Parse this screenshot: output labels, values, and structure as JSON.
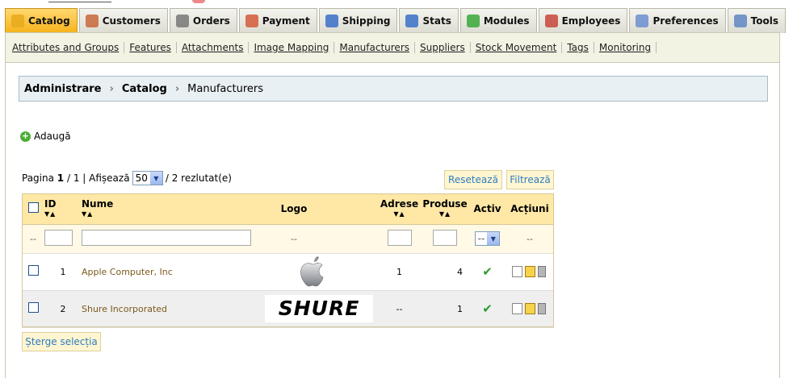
{
  "tabs": [
    {
      "label": "Catalog",
      "icon": "folder-icon",
      "active": true
    },
    {
      "label": "Customers",
      "icon": "customer-icon"
    },
    {
      "label": "Orders",
      "icon": "cart-icon"
    },
    {
      "label": "Payment",
      "icon": "payment-icon"
    },
    {
      "label": "Shipping",
      "icon": "truck-icon"
    },
    {
      "label": "Stats",
      "icon": "stats-icon"
    },
    {
      "label": "Modules",
      "icon": "puzzle-icon"
    },
    {
      "label": "Employees",
      "icon": "employee-icon"
    },
    {
      "label": "Preferences",
      "icon": "preferences-icon"
    },
    {
      "label": "Tools",
      "icon": "tools-icon"
    }
  ],
  "sublinks": [
    "Attributes and Groups",
    "Features",
    "Attachments",
    "Image Mapping",
    "Manufacturers",
    "Suppliers",
    "Stock Movement",
    "Tags",
    "Monitoring"
  ],
  "breadcrumb": {
    "root": "Administrare",
    "section": "Catalog",
    "current": "Manufacturers"
  },
  "add_label": "Adaugă",
  "pager": {
    "prefix": "Pagina",
    "page": "1",
    "suffix": "/ 1 | Afișează",
    "per_page": "50",
    "result": "/ 2 rezlutat(e)"
  },
  "buttons": {
    "reset": "Resetează",
    "filter": "Filtrează",
    "delete_selection": "Șterge selecția"
  },
  "columns": {
    "id": "ID",
    "name": "Nume",
    "logo": "Logo",
    "addresses": "Adrese",
    "products": "Produse",
    "active": "Activ",
    "actions": "Acțiuni"
  },
  "filter_row": {
    "dash": "--",
    "active_value": "--"
  },
  "rows": [
    {
      "id": "1",
      "name": "Apple Computer, Inc",
      "addresses": "1",
      "products": "4"
    },
    {
      "id": "2",
      "name": "Shure Incorporated",
      "addresses": "--",
      "products": "1",
      "logo_text": "SHURE"
    }
  ],
  "colors": {
    "active_tab": "#f6b21a",
    "header": "#ffe8a6",
    "breadcrumb": "#e9f0f3",
    "link": "#2f7cc0"
  }
}
